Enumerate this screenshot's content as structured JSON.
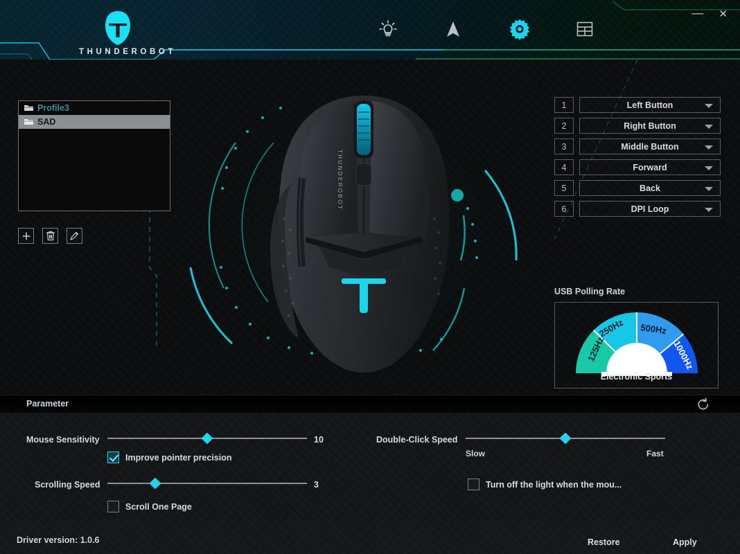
{
  "window": {
    "minimize_label": "—",
    "close_label": "✕"
  },
  "header": {
    "brand": "THUNDEROBOT",
    "logo_icon": "thunderobot-helmet-icon",
    "nav": [
      {
        "id": "lighting",
        "icon": "lightbulb-icon",
        "active": false
      },
      {
        "id": "pointer",
        "icon": "cursor-arrow-icon",
        "active": false
      },
      {
        "id": "settings",
        "icon": "gear-icon",
        "active": true
      },
      {
        "id": "macro",
        "icon": "table-grid-icon",
        "active": false
      }
    ],
    "accent_cyan": "#1ec8e0",
    "accent_green": "#1f9e55"
  },
  "profiles": {
    "items": [
      {
        "name": "Profile3",
        "selected": false,
        "color": "#3f8c9b"
      },
      {
        "name": "SAD",
        "selected": true,
        "color": "#17191a"
      }
    ],
    "tools": [
      {
        "id": "add",
        "icon": "plus-icon",
        "label": "Add profile"
      },
      {
        "id": "delete",
        "icon": "trash-icon",
        "label": "Delete profile"
      },
      {
        "id": "rename",
        "icon": "pencil-icon",
        "label": "Rename profile"
      }
    ]
  },
  "device": {
    "product_mark": "THUNDEROBOT",
    "logo_glyph": "T",
    "image_name": "gaming-mouse-top-view"
  },
  "assignments": [
    {
      "number": "1",
      "value": "Left Button"
    },
    {
      "number": "2",
      "value": "Right Button"
    },
    {
      "number": "3",
      "value": "Middle Button"
    },
    {
      "number": "4",
      "value": "Forward"
    },
    {
      "number": "5",
      "value": "Back"
    },
    {
      "number": "6",
      "value": "DPI Loop"
    }
  ],
  "polling": {
    "title": "USB Polling Rate",
    "caption": "Electronic Sports",
    "selected": "1000Hz",
    "segments": [
      {
        "label": "125Hz",
        "color": "#17c9a6"
      },
      {
        "label": "250Hz",
        "color": "#18c6e8"
      },
      {
        "label": "500Hz",
        "color": "#2f9cf0"
      },
      {
        "label": "1000Hz",
        "color": "#1156f0"
      }
    ]
  },
  "parameter": {
    "section_title": "Parameter",
    "reset_icon": "reset-arrow-icon",
    "mouse_sensitivity": {
      "label": "Mouse Sensitivity",
      "value": "10",
      "percent": 50
    },
    "improve_precision": {
      "label": "Improve pointer precision",
      "checked": true
    },
    "scrolling_speed": {
      "label": "Scrolling Speed",
      "value": "3",
      "percent": 24
    },
    "scroll_one_page": {
      "label": "Scroll One Page",
      "checked": false
    },
    "double_click_speed": {
      "label": "Double-Click Speed",
      "percent": 50,
      "min_label": "Slow",
      "max_label": "Fast"
    },
    "turn_off_light": {
      "label": "Turn off the light when the mou...",
      "checked": false
    }
  },
  "footer": {
    "driver_version": "Driver version: 1.0.6",
    "restore_label": "Restore",
    "apply_label": "Apply"
  }
}
